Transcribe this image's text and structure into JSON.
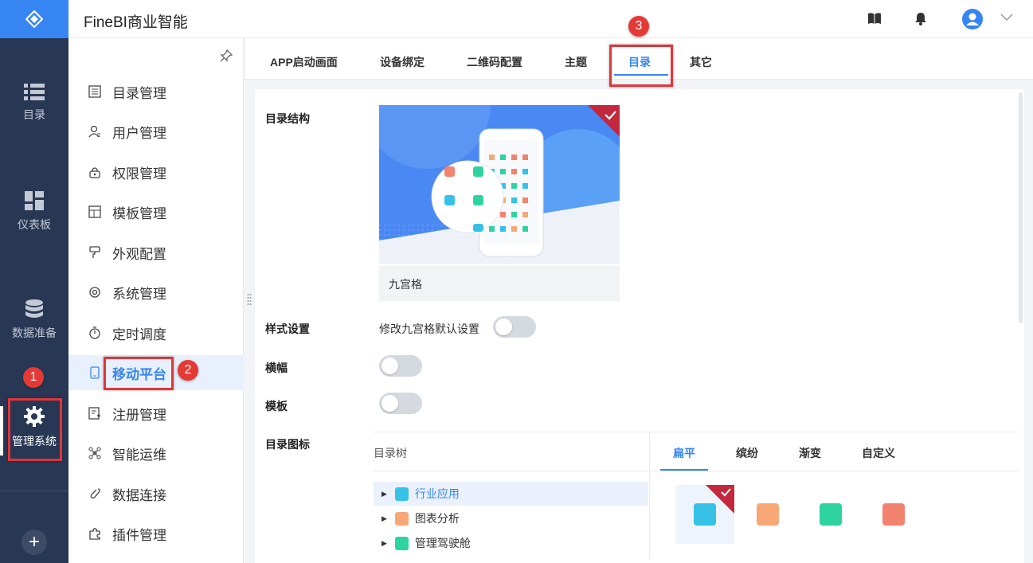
{
  "app": {
    "title": "FineBI商业智能"
  },
  "rail": {
    "items": [
      {
        "label": "目录",
        "icon": "list-icon"
      },
      {
        "label": "仪表板",
        "icon": "dashboard-icon"
      },
      {
        "label": "数据准备",
        "icon": "database-icon"
      },
      {
        "label": "管理系统",
        "icon": "gear-icon"
      }
    ],
    "plus": "+"
  },
  "sidebar": {
    "items": [
      {
        "label": "目录管理",
        "icon": "directory-icon"
      },
      {
        "label": "用户管理",
        "icon": "user-icon"
      },
      {
        "label": "权限管理",
        "icon": "lock-icon"
      },
      {
        "label": "模板管理",
        "icon": "template-icon"
      },
      {
        "label": "外观配置",
        "icon": "paint-roller-icon"
      },
      {
        "label": "系统管理",
        "icon": "settings-icon"
      },
      {
        "label": "定时调度",
        "icon": "timer-icon"
      },
      {
        "label": "移动平台",
        "icon": "mobile-icon"
      },
      {
        "label": "注册管理",
        "icon": "register-icon"
      },
      {
        "label": "智能运维",
        "icon": "ops-icon"
      },
      {
        "label": "数据连接",
        "icon": "link-icon"
      },
      {
        "label": "插件管理",
        "icon": "plugin-icon"
      }
    ],
    "active_index": 7
  },
  "tabs": [
    "APP启动画面",
    "设备绑定",
    "二维码配置",
    "主题",
    "目录",
    "其它"
  ],
  "active_tab": "目录",
  "content": {
    "structure_label": "目录结构",
    "preview_caption": "九宫格",
    "style_label": "样式设置",
    "style_toggle_text": "修改九宫格默认设置",
    "landscape_label": "横幅",
    "template_label": "模板",
    "icon_label": "目录图标"
  },
  "tree": {
    "header": "目录树",
    "rows": [
      {
        "label": "行业应用",
        "color": "#35c2e6"
      },
      {
        "label": "图表分析",
        "color": "#f8a877"
      },
      {
        "label": "管理驾驶舱",
        "color": "#2dd4a0"
      }
    ]
  },
  "icon_tabs": [
    "扁平",
    "缤纷",
    "渐变",
    "自定义"
  ],
  "icon_colors": [
    "#35c2e6",
    "#f8a877",
    "#2dd4a0",
    "#f2836f"
  ],
  "annotations": [
    "1",
    "2",
    "3"
  ],
  "colors": {
    "accent": "#3685f2",
    "rail": "#283754",
    "marker": "#e53935"
  }
}
